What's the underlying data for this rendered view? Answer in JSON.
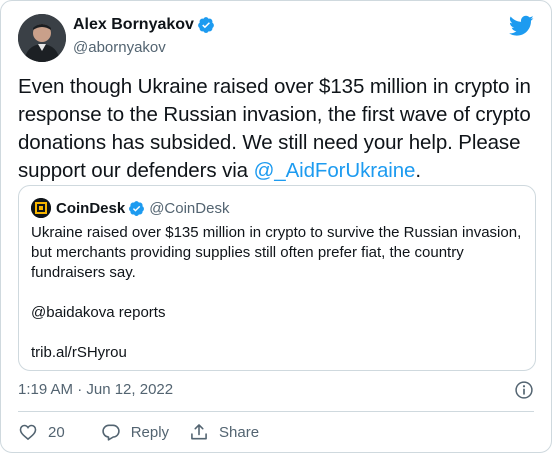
{
  "author": {
    "name": "Alex Bornyakov",
    "handle": "@abornyakov"
  },
  "tweet": {
    "text_before_link": "Even though Ukraine raised over $135 million in crypto in response to the Russian invasion, the first wave of crypto donations has subsided. We still need your help. Please support our defenders via ",
    "link_text": "@_AidForUkraine",
    "text_after_link": "."
  },
  "quote": {
    "name": "CoinDesk",
    "handle": "@CoinDesk",
    "paragraph1": "Ukraine raised over $135 million in crypto to survive the Russian invasion, but merchants providing supplies still often prefer fiat, the country fundraisers say.",
    "paragraph2": "@baidakova reports",
    "paragraph3": "trib.al/rSHyrou"
  },
  "timestamp": "1:19 AM · Jun 12, 2022",
  "actions": {
    "like_count": "20",
    "reply_label": "Reply",
    "share_label": "Share"
  },
  "colors": {
    "accent": "#1d9bf0",
    "text": "#0f1419",
    "muted": "#536471",
    "border": "#cfd9de",
    "coindesk_logo": "#f7b500"
  },
  "icons": [
    "verified-badge-icon",
    "twitter-bird-icon",
    "coindesk-logo-icon",
    "info-icon",
    "heart-icon",
    "reply-icon",
    "share-icon"
  ]
}
